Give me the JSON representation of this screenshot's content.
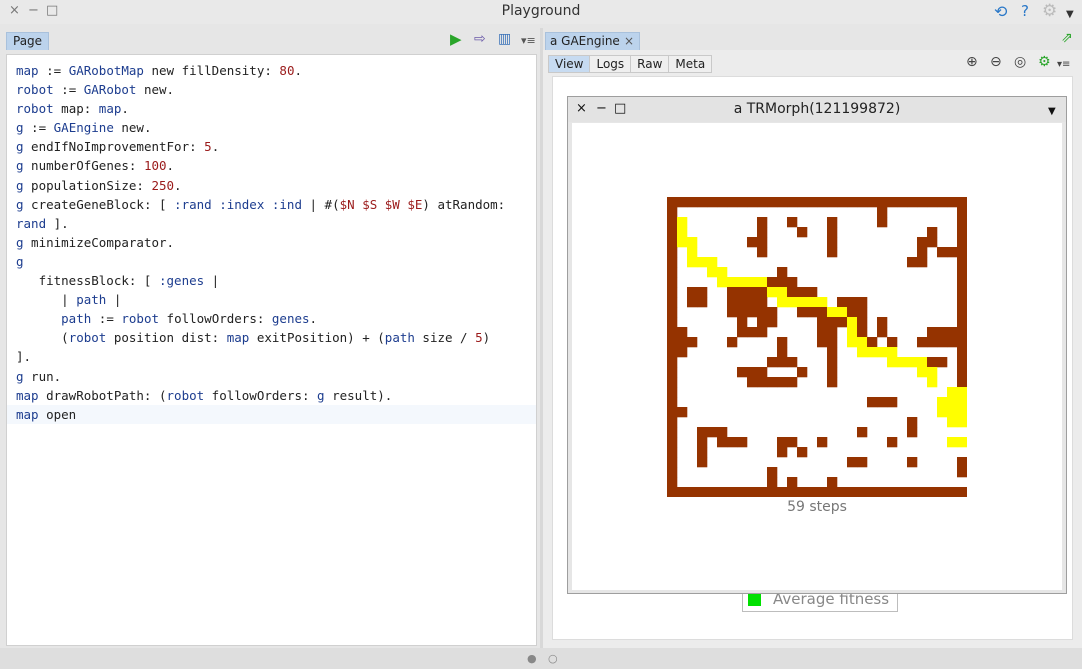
{
  "window": {
    "title": "Playground",
    "close_glyph": "×",
    "minimize_glyph": "−",
    "maximize_glyph": "□",
    "icons": [
      "sync-icon",
      "help-icon",
      "settings-icon",
      "chevron-down-icon"
    ]
  },
  "left": {
    "tab_label": "Page",
    "toolbar_icons": [
      "run-icon",
      "bindings-icon",
      "inspector-icon",
      "menu-icon"
    ],
    "code_lines": [
      [
        [
          "var",
          "map"
        ],
        [
          "kw",
          " := "
        ],
        [
          "cls",
          "GARobotMap"
        ],
        [
          "kw",
          " new fillDensity: "
        ],
        [
          "num",
          "80"
        ],
        [
          "kw",
          "."
        ]
      ],
      [
        [
          "var",
          "robot"
        ],
        [
          "kw",
          " := "
        ],
        [
          "cls",
          "GARobot"
        ],
        [
          "kw",
          " new."
        ]
      ],
      [
        [
          "var",
          "robot"
        ],
        [
          "kw",
          " map: "
        ],
        [
          "var",
          "map"
        ],
        [
          "kw",
          "."
        ]
      ],
      [
        [
          "var",
          "g"
        ],
        [
          "kw",
          " := "
        ],
        [
          "cls",
          "GAEngine"
        ],
        [
          "kw",
          " new."
        ]
      ],
      [
        [
          "var",
          "g"
        ],
        [
          "kw",
          " endIfNoImprovementFor: "
        ],
        [
          "num",
          "5"
        ],
        [
          "kw",
          "."
        ]
      ],
      [
        [
          "var",
          "g"
        ],
        [
          "kw",
          " numberOfGenes: "
        ],
        [
          "num",
          "100"
        ],
        [
          "kw",
          "."
        ]
      ],
      [
        [
          "var",
          "g"
        ],
        [
          "kw",
          " populationSize: "
        ],
        [
          "num",
          "250"
        ],
        [
          "kw",
          "."
        ]
      ],
      [
        [
          "var",
          "g"
        ],
        [
          "kw",
          " createGeneBlock: [ "
        ],
        [
          "sym",
          ":rand :index :ind"
        ],
        [
          "kw",
          " | #("
        ],
        [
          "chr",
          "$N $S $W $E"
        ],
        [
          "kw",
          ") atRandom:"
        ]
      ],
      [
        [
          "var",
          "rand"
        ],
        [
          "kw",
          " ]."
        ]
      ],
      [
        [
          "var",
          "g"
        ],
        [
          "kw",
          " minimizeComparator."
        ]
      ],
      [
        [
          "var",
          "g"
        ]
      ],
      [
        [
          "kw",
          "   fitnessBlock: [ "
        ],
        [
          "sym",
          ":genes"
        ],
        [
          "kw",
          " |"
        ]
      ],
      [
        [
          "kw",
          "      | "
        ],
        [
          "var",
          "path"
        ],
        [
          "kw",
          " |"
        ]
      ],
      [
        [
          "kw",
          "      "
        ],
        [
          "var",
          "path"
        ],
        [
          "kw",
          " := "
        ],
        [
          "var",
          "robot"
        ],
        [
          "kw",
          " followOrders: "
        ],
        [
          "var",
          "genes"
        ],
        [
          "kw",
          "."
        ]
      ],
      [
        [
          "kw",
          "      ("
        ],
        [
          "var",
          "robot"
        ],
        [
          "kw",
          " position dist: "
        ],
        [
          "var",
          "map"
        ],
        [
          "kw",
          " exitPosition) + ("
        ],
        [
          "var",
          "path"
        ],
        [
          "kw",
          " size / "
        ],
        [
          "num",
          "5"
        ],
        [
          "kw",
          ")"
        ]
      ],
      [
        [
          "kw",
          "]."
        ]
      ],
      [
        [
          "var",
          "g"
        ],
        [
          "kw",
          " run."
        ]
      ],
      [
        [
          "var",
          "map"
        ],
        [
          "kw",
          " drawRobotPath: ("
        ],
        [
          "var",
          "robot"
        ],
        [
          "kw",
          " followOrders: "
        ],
        [
          "var",
          "g"
        ],
        [
          "kw",
          " result)."
        ]
      ],
      [
        [
          "var",
          "map"
        ],
        [
          "kw",
          " open"
        ]
      ]
    ]
  },
  "right": {
    "tab_label": "a GAEngine",
    "tab_close": "×",
    "subtabs": [
      "View",
      "Logs",
      "Raw",
      "Meta"
    ],
    "active_subtab": "View",
    "toolbar_icons": [
      "zoom-in-icon",
      "zoom-out-icon",
      "zoom-reset-icon",
      "settings-icon"
    ],
    "legend_label": "Average fitness",
    "legend_color": "#00e000"
  },
  "morph": {
    "title": "a TRMorph(121199872)",
    "steps_label": "59 steps",
    "colors": {
      "wall": "#953300",
      "path": "#ffff00",
      "floor": "#ffffff"
    },
    "maze_rows": [
      "##############################",
      "#....................#.......#",
      "#Y.......#..#...#....#.......#",
      "#Y.......#...#..#.........#..#",
      "#YY.....##......#........##..#",
      "#.Y......#......#........#.###",
      "#.YYY...................##...#",
      "#...YY.....#.................#",
      "#....YYYYY###................#",
      "#.##..####YY###..............#",
      "#.##..####.YYYYY.###.........#",
      "#.....#####..###YY##.........#",
      "#......#.##....###Y#.#.......#",
      "##.....###.....##.Y#.#....####",
      "###...#....#...##.YY#.#..#####",
      "##.........#....#..YYYY......#",
      "#.........###...#.....YYYY##.#",
      "#......###...#..#........YY..#",
      "#.......#####...#.........Y..#",
      "#...........................YY#",
      "#...................###....YYY",
      "##.........................YYY",
      "#.......................#...YY",
      "#..###.............#....#.....",
      "#..#.###...##..#......#.....YY",
      "#..#.......#.#.................",
      "#..#..............##....#....#",
      "#.........#..................#",
      "#.........#.#...#..............",
      "##############################"
    ]
  }
}
